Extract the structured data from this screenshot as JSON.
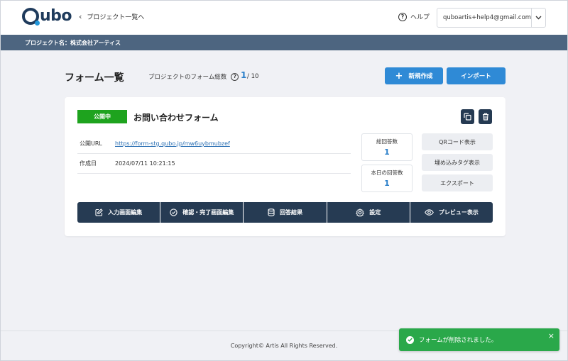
{
  "header": {
    "logo_text": "ubo",
    "back_label": "プロジェクト一覧へ",
    "help_label": "ヘルプ",
    "account_email": "quboartis+help4@gmail.com"
  },
  "project_bar": {
    "label": "プロジェクト名：株式会社アーティス"
  },
  "page": {
    "title": "フォーム一覧",
    "total_label": "プロジェクトのフォーム総数",
    "total_count": "1",
    "total_max": "/ 10",
    "new_button": "新規作成",
    "import_button": "インポート"
  },
  "form": {
    "status": "公開中",
    "name": "お問い合わせフォーム",
    "url_label": "公開URL",
    "url": "https://form-stg.qubo.jp/mw6uybmubzef",
    "date_label": "作成日",
    "date": "2024/07/11 10:21:15",
    "total_answers_label": "総回答数",
    "total_answers": "1",
    "today_answers_label": "本日の回答数",
    "today_answers": "1",
    "qr_button": "QRコード表示",
    "embed_button": "埋め込みタグ表示",
    "export_button": "エクスポート",
    "actions": {
      "edit_input": "入力画面編集",
      "edit_confirm": "確認・完了画面編集",
      "results": "回答結果",
      "settings": "設定",
      "preview": "プレビュー表示"
    }
  },
  "footer": {
    "copyright": "Copyright© Artis All Rights Reserved."
  },
  "toast": {
    "message": "フォームが削除されました。",
    "close": "×"
  },
  "colors": {
    "brand_dark": "#263b53",
    "accent_blue": "#2f8ad6",
    "status_green": "#1ea31e",
    "toast_green": "#2aa84a",
    "project_bar": "#4d6580"
  }
}
